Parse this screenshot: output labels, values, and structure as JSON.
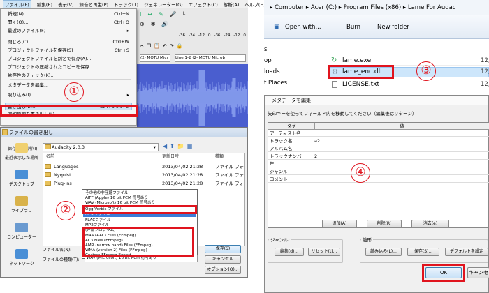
{
  "audacity": {
    "menubar": [
      "ファイル(F)",
      "編集(E)",
      "表示(V)",
      "録音と再生(P)",
      "トラック(T)",
      "ジェネレーター(G)",
      "エフェクト(C)",
      "解析(A)",
      "ヘルプ(H)"
    ],
    "toolbar_values": [
      "-36",
      "-24",
      "-12",
      "0",
      "-36",
      "-24",
      "-12",
      "0"
    ],
    "device_labels": [
      "(2- MOTU Micr",
      "Line 1-2 (2- MOTU Microb"
    ],
    "file_menu": [
      {
        "label": "新規(N)",
        "shortcut": "Ctrl+N"
      },
      {
        "label": "開く(O)...",
        "shortcut": "Ctrl+O"
      },
      {
        "label": "最近のファイル(F)",
        "shortcut": "▸"
      },
      {
        "label": "閉じる(C)",
        "shortcut": "Ctrl+W"
      },
      {
        "label": "プロジェクトファイルを保存(S)",
        "shortcut": "Ctrl+S"
      },
      {
        "label": "プロジェクトファイルを別名で保存(A)...",
        "shortcut": ""
      },
      {
        "label": "プロジェクトの圧縮されたコピーを保存...",
        "shortcut": ""
      },
      {
        "label": "依存性のチェック(K)...",
        "shortcut": ""
      },
      {
        "label": "メタデータを編集...",
        "shortcut": ""
      },
      {
        "label": "取り込み(I)",
        "shortcut": "▸"
      },
      {
        "label": "書き出し(E)...",
        "shortcut": "Ctrl+Shift+E"
      },
      {
        "label": "選択範囲を書き出し(L)...",
        "shortcut": ""
      }
    ]
  },
  "export_dialog": {
    "title": "ファイルの書き出し",
    "save_in_label": "保存する場所(I):",
    "folder": "Audacity 2.0.3",
    "places": [
      "最近表示した場所",
      "デスクトップ",
      "ライブラリ",
      "コンピューター",
      "ネットワーク"
    ],
    "columns": {
      "name": "名前",
      "date": "更新日時",
      "type": "種類"
    },
    "files": [
      {
        "name": "Languages",
        "date": "2013/04/02 21:28",
        "type": "ファイル フォ"
      },
      {
        "name": "Nyquist",
        "date": "2013/04/02 21:28",
        "type": "ファイル フォ"
      },
      {
        "name": "Plug-Ins",
        "date": "2013/04/02 21:28",
        "type": "ファイル フォ"
      }
    ],
    "format_options": [
      "その他の非圧縮ファイル",
      "AIFF (Apple) 16 bit PCM 符号あり",
      "WAV (Microsoft) 16 bit PCM 符号あり",
      "Ogg Vorbis ファイル",
      "MP3 ファイル",
      "FLACファイル",
      "MP2ファイル",
      "(外部プログラム)",
      "M4A (AAC) Files (FFmpeg)",
      "AC3 Files (FFmpeg)",
      "AMR (narrow band) Files (FFmpeg)",
      "WMA (version 2) Files (FFmpeg)",
      "Custom FFmpeg Export"
    ],
    "filename_label": "ファイル名(N):",
    "filetype_label": "ファイルの種類(T):",
    "filetype_value": "WAV (Microsoft) 16 bit PCM 符号あり",
    "buttons": {
      "save": "保存(S)",
      "cancel": "キャンセル",
      "options": "オプション(O)..."
    }
  },
  "explorer": {
    "breadcrumb": [
      "Computer",
      "Acer (C:)",
      "Program Files (x86)",
      "Lame For Audac"
    ],
    "commands": {
      "open_with": "Open with...",
      "burn": "Burn",
      "new_folder": "New folder"
    },
    "nav": [
      "s",
      "op",
      "loads",
      "t Places"
    ],
    "files": [
      {
        "name": "lame.exe",
        "date": "12,"
      },
      {
        "name": "lame_enc.dll",
        "date": "12,"
      },
      {
        "name": "LICENSE.txt",
        "date": "12,"
      },
      {
        "name": "",
        "date": ""
      }
    ]
  },
  "metadata_dialog": {
    "title": "メタデータを編集",
    "instruction": "矢印キーを使ってフィールド内を移動してください（編集後はリターン）",
    "col_tag": "タグ",
    "col_value": "値",
    "rows": [
      {
        "tag": "アーティスト名",
        "value": ""
      },
      {
        "tag": "トラック名",
        "value": "a2"
      },
      {
        "tag": "アルバム名",
        "value": ""
      },
      {
        "tag": "トラックナンバー",
        "value": "2"
      },
      {
        "tag": "年",
        "value": ""
      },
      {
        "tag": "ジャンル",
        "value": ""
      },
      {
        "tag": "コメント",
        "value": ""
      }
    ],
    "row_buttons": {
      "add": "追加(A)",
      "remove": "削除(R)",
      "clear": "消去(e)"
    },
    "genre_group": "ジャンル:",
    "template_group": "雛形",
    "genre_buttons": {
      "edit": "編集(d)...",
      "reset": "リセット(t)..."
    },
    "template_buttons": {
      "load": "読み込み(L)...",
      "save": "保存(S)...",
      "default": "デフォルトを設定"
    },
    "ok": "OK",
    "cancel": "キャンセ"
  },
  "annotations": [
    "①",
    "②",
    "③",
    "④"
  ],
  "colors": {
    "highlight_red": "#e0141e",
    "waveform": "#4a5ecf"
  }
}
